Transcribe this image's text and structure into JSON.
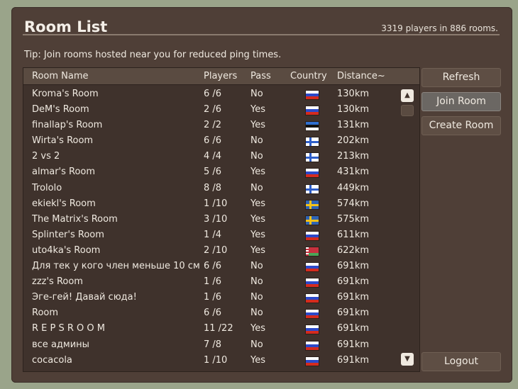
{
  "window": {
    "title": "Room List",
    "counter": "3319 players in 886 rooms.",
    "tip": "Tip: Join rooms hosted near you for reduced ping times."
  },
  "columns": {
    "name": "Room Name",
    "players": "Players",
    "pass": "Pass",
    "country": "Country",
    "distance": "Distance~"
  },
  "rooms": [
    {
      "name": "Kroma's Room",
      "players": "6 /6",
      "pass": "No",
      "flag": "ru",
      "distance": "130km"
    },
    {
      "name": "DeM's Room",
      "players": "2 /6",
      "pass": "Yes",
      "flag": "ru",
      "distance": "130km"
    },
    {
      "name": "finallap's Room",
      "players": "2 /2",
      "pass": "Yes",
      "flag": "ee",
      "distance": "131km"
    },
    {
      "name": "Wirta's Room",
      "players": "6 /6",
      "pass": "No",
      "flag": "fi",
      "distance": "202km"
    },
    {
      "name": "2 vs 2",
      "players": "4 /4",
      "pass": "No",
      "flag": "fi",
      "distance": "213km"
    },
    {
      "name": "almar's Room",
      "players": "5 /6",
      "pass": "Yes",
      "flag": "ru",
      "distance": "431km"
    },
    {
      "name": "Trololo",
      "players": "8 /8",
      "pass": "No",
      "flag": "fi",
      "distance": "449km"
    },
    {
      "name": "ekiekl's Room",
      "players": "1 /10",
      "pass": "Yes",
      "flag": "se",
      "distance": "574km"
    },
    {
      "name": "The Matrix's Room",
      "players": "3 /10",
      "pass": "Yes",
      "flag": "se",
      "distance": "575km"
    },
    {
      "name": "Splinter's Room",
      "players": "1 /4",
      "pass": "Yes",
      "flag": "ru",
      "distance": "611km"
    },
    {
      "name": "uto4ka's Room",
      "players": "2 /10",
      "pass": "Yes",
      "flag": "by",
      "distance": "622km"
    },
    {
      "name": "Для тек у кого член меньше 10 см",
      "players": "6 /6",
      "pass": "No",
      "flag": "ru",
      "distance": "691km"
    },
    {
      "name": "zzz's Room",
      "players": "1 /6",
      "pass": "No",
      "flag": "ru",
      "distance": "691km"
    },
    {
      "name": "Эге-гей! Давай сюда!",
      "players": "1 /6",
      "pass": "No",
      "flag": "ru",
      "distance": "691km"
    },
    {
      "name": "Room",
      "players": "6 /6",
      "pass": "No",
      "flag": "ru",
      "distance": "691km"
    },
    {
      "name": "R E P S    R O O M",
      "players": "11 /22",
      "pass": "Yes",
      "flag": "ru",
      "distance": "691km"
    },
    {
      "name": "все админы",
      "players": "7 /8",
      "pass": "No",
      "flag": "ru",
      "distance": "691km"
    },
    {
      "name": "cocacola",
      "players": "1 /10",
      "pass": "Yes",
      "flag": "ru",
      "distance": "691km"
    }
  ],
  "scroll": {
    "up_icon": "▲",
    "down_icon": "▼"
  },
  "buttons": {
    "refresh": "Refresh",
    "join": "Join Room",
    "create": "Create Room",
    "logout": "Logout"
  }
}
